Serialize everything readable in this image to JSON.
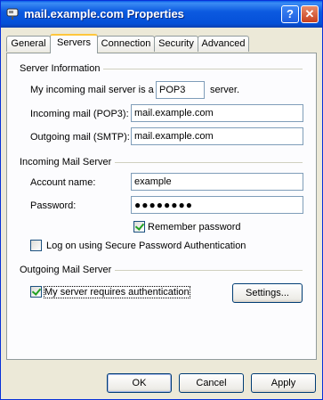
{
  "window": {
    "title": "mail.example.com Properties",
    "help_label": "?",
    "close_label": "✕",
    "icon": "mailbox-icon"
  },
  "tabs": [
    {
      "label": "General",
      "active": false
    },
    {
      "label": "Servers",
      "active": true
    },
    {
      "label": "Connection",
      "active": false
    },
    {
      "label": "Security",
      "active": false
    },
    {
      "label": "Advanced",
      "active": false
    }
  ],
  "server_info": {
    "heading": "Server Information",
    "incoming_prefix": "My incoming mail server is a",
    "server_type": "POP3",
    "incoming_suffix": "server.",
    "incoming_label": "Incoming mail (POP3):",
    "incoming_value": "mail.example.com",
    "outgoing_label": "Outgoing mail (SMTP):",
    "outgoing_value": "mail.example.com"
  },
  "incoming_server": {
    "heading": "Incoming Mail Server",
    "account_label": "Account name:",
    "account_value": "example",
    "password_label": "Password:",
    "password_value": "●●●●●●●●",
    "remember_label": "Remember password",
    "remember_checked": true,
    "spa_label": "Log on using Secure Password Authentication",
    "spa_checked": false
  },
  "outgoing_server": {
    "heading": "Outgoing Mail Server",
    "auth_label": "My server requires authentication",
    "auth_checked": true,
    "settings_label": "Settings..."
  },
  "footer": {
    "ok_label": "OK",
    "cancel_label": "Cancel",
    "apply_label": "Apply"
  },
  "colors": {
    "titlebar": "#0450d8",
    "dialog_bg": "#ece9d8",
    "panel_bg": "#fcfcfe",
    "active_tab_accent": "#ffc73c",
    "check_mark": "#21a121"
  }
}
